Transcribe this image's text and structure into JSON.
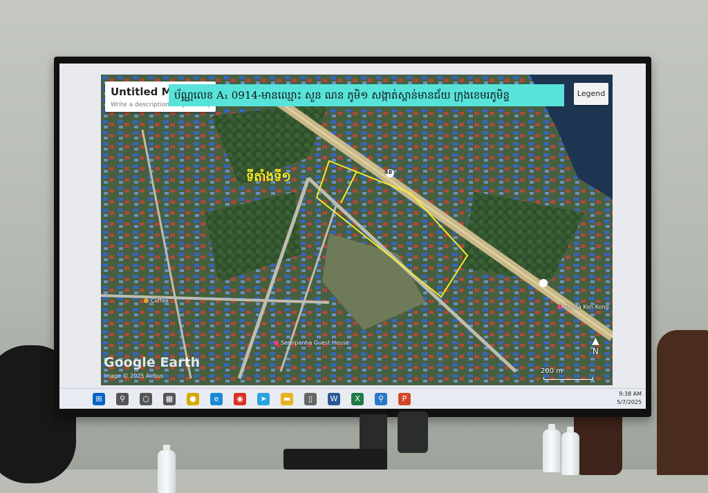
{
  "map": {
    "title": "Untitled Map",
    "description_placeholder": "Write a description for your map.",
    "banner_text": "ប័ណ្ណលេខ  A₁ 0914-មានឈ្មោះ សួន ណន ភូមិ១ សង្កាត់ស្ពាន់មានជ័យ ក្រុងខេមរភូមិន្ទ",
    "legend_label": "Legend",
    "site_label": "ទីតាំងទី១",
    "pois": [
      {
        "name": "Coffee",
        "color": "#e8a13a"
      },
      {
        "name": "Sereipanha Guest House",
        "color": "#e0457b"
      },
      {
        "name": "Thyda Kon Kong",
        "color": "#e0457b"
      }
    ],
    "road_number": "48",
    "attribution_logo": "Google Earth",
    "attribution_credit": "Image © 2025 Airbus",
    "scale_label": "200 m",
    "compass_label": "N",
    "colors": {
      "banner": "#57e3da",
      "parcel_outline": "#f4ec2a",
      "highway": "#c9b98a"
    }
  },
  "taskbar": {
    "icons": [
      {
        "name": "windows-start-icon",
        "glyph": "⊞",
        "color": "#0a64c8"
      },
      {
        "name": "search-icon",
        "glyph": "⚲",
        "color": "#555"
      },
      {
        "name": "task-view-icon",
        "glyph": "○",
        "color": "#555"
      },
      {
        "name": "widgets-icon",
        "glyph": "▦",
        "color": "#555"
      },
      {
        "name": "norton-icon",
        "glyph": "●",
        "color": "#d6a800"
      },
      {
        "name": "edge-icon",
        "glyph": "e",
        "color": "#1b8ad6"
      },
      {
        "name": "chrome-icon",
        "glyph": "◉",
        "color": "#d93025"
      },
      {
        "name": "telegram-icon",
        "glyph": "➤",
        "color": "#2aa3e0"
      },
      {
        "name": "file-explorer-icon",
        "glyph": "▬",
        "color": "#e6b422"
      },
      {
        "name": "notepad-icon",
        "glyph": "▯",
        "color": "#666"
      },
      {
        "name": "word-icon",
        "glyph": "W",
        "color": "#2b5797"
      },
      {
        "name": "excel-icon",
        "glyph": "X",
        "color": "#1f7a44"
      },
      {
        "name": "magnifier-icon",
        "glyph": "⚲",
        "color": "#2a78c6"
      },
      {
        "name": "powerpoint-icon",
        "glyph": "P",
        "color": "#d24726"
      }
    ],
    "time": "9:38 AM",
    "date": "5/7/2025"
  }
}
